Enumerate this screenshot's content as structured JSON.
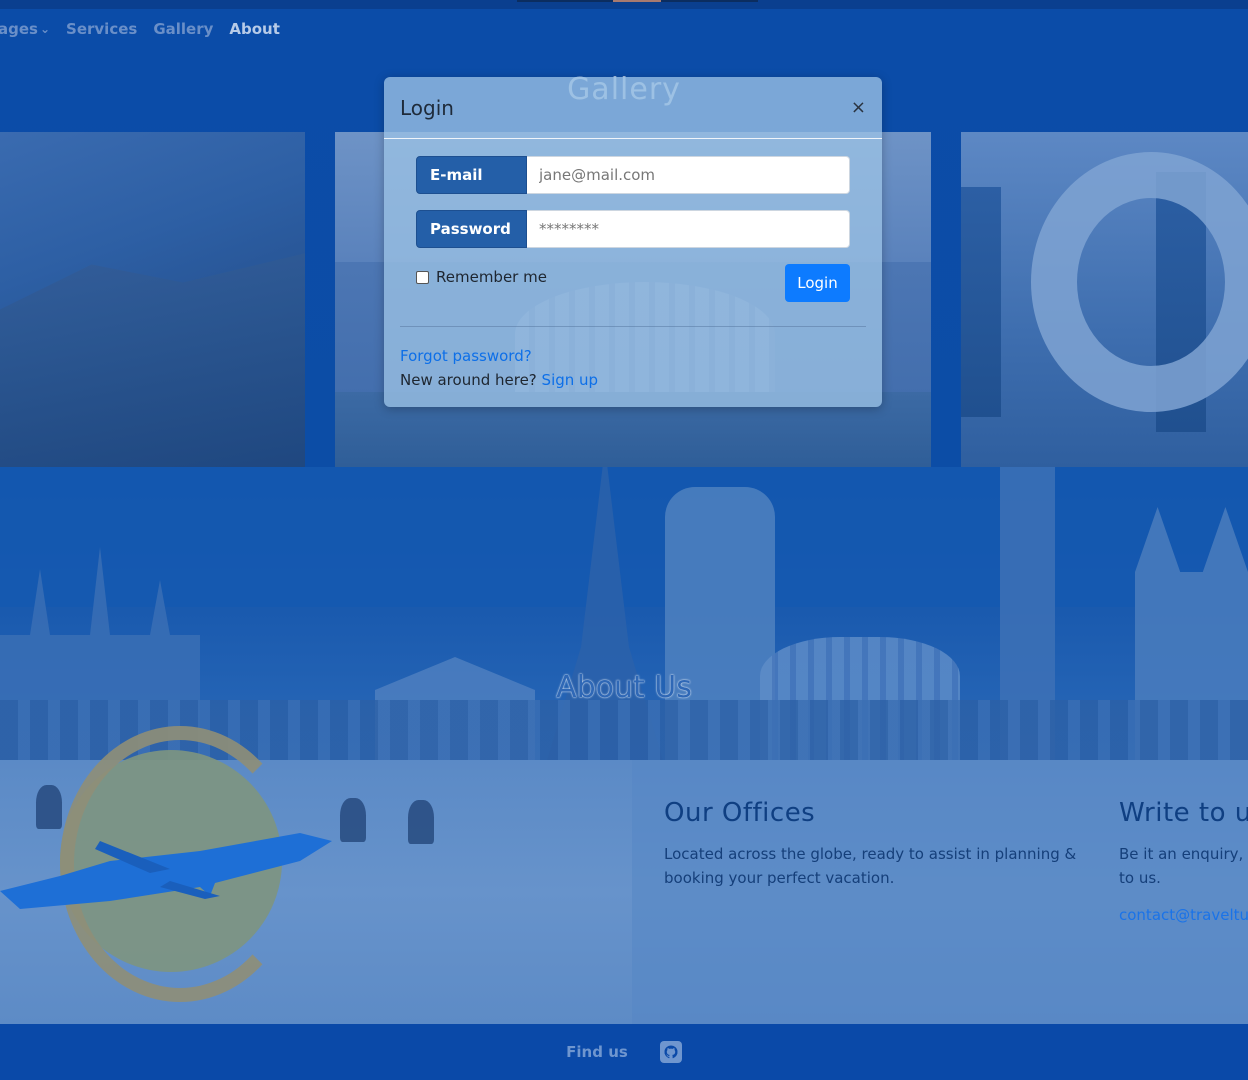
{
  "nav": {
    "items": [
      {
        "label": "ages",
        "active": false
      },
      {
        "label": "Services",
        "active": false
      },
      {
        "label": "Gallery",
        "active": false
      },
      {
        "label": "About",
        "active": true
      }
    ]
  },
  "gallery": {
    "title": "Gallery"
  },
  "about": {
    "title": "About Us"
  },
  "offices": {
    "heading": "Our Offices",
    "text": "Located across the globe, ready to assist in planning & booking your perfect vacation."
  },
  "write": {
    "heading": "Write to us",
    "text": "Be it an enquiry, f to us.",
    "email": "contact@traveltu"
  },
  "footer": {
    "find_us": "Find us"
  },
  "modal": {
    "title": "Login",
    "close_glyph": "×",
    "email_label": "E-mail",
    "email_placeholder": "jane@mail.com",
    "password_label": "Password",
    "password_placeholder": "********",
    "remember_label": "Remember me",
    "login_button": "Login",
    "forgot_link": "Forgot password?",
    "new_here_text": "New around here?",
    "signup_link": "Sign up"
  },
  "colors": {
    "primary_button": "#0d7bff",
    "label_bg": "#245fa8",
    "link": "#0d6fe8",
    "page_overlay": "#0a4aa6"
  }
}
